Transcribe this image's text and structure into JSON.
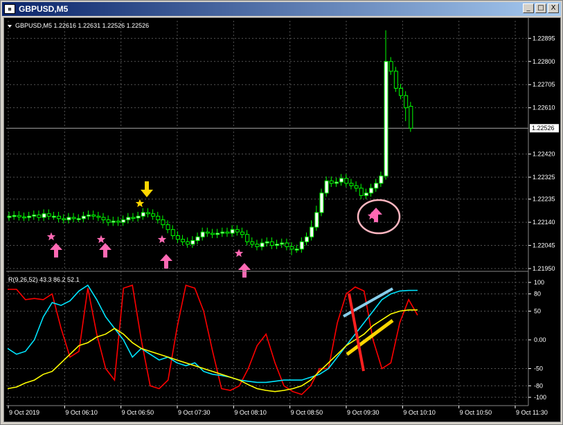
{
  "window": {
    "title": "GBPUSD,M5",
    "buttons": [
      "_",
      "□",
      "X"
    ]
  },
  "main_chart": {
    "header": "GBPUSD,M5  1.22616 1.22631 1.22526 1.22526",
    "current_price_label": "1.22526",
    "colors": {
      "background": "#000000",
      "bull_candle": "#ffffff",
      "candle_wick": "#00ff00",
      "grid": "#555555",
      "buy_arrow": "#ff69b4",
      "sell_arrow": "#ffd700",
      "highlight_circle": "#ffb6c1"
    }
  },
  "indicator": {
    "header": "R(9,26,52) 43.3 86.2 52.1",
    "colors": {
      "fast": "#ff0000",
      "medium": "#00e5ff",
      "slow": "#ffff00",
      "trend_light_blue": "#87ceeb",
      "trend_yellow": "#ffd700",
      "trend_red": "#ff2020"
    }
  },
  "chart_data": [
    {
      "type": "candlestick",
      "title": "GBPUSD,M5",
      "y_ticks": [
        "1.22895",
        "1.22800",
        "1.22705",
        "1.22610",
        "1.22420",
        "1.22325",
        "1.22235",
        "1.22140",
        "1.22045",
        "1.21950"
      ],
      "ylim": [
        1.2195,
        1.2295
      ],
      "x_ticks": [
        "9 Oct 2019",
        "9 Oct 06:10",
        "9 Oct 06:50",
        "9 Oct 07:30",
        "9 Oct 08:10",
        "9 Oct 08:50",
        "9 Oct 09:30",
        "9 Oct 10:10",
        "9 Oct 10:50",
        "9 Oct 11:30"
      ],
      "grid": true,
      "close": [
        1.22165,
        1.22168,
        1.22162,
        1.2216,
        1.22165,
        1.2217,
        1.2216,
        1.22175,
        1.22165,
        1.22165,
        1.22155,
        1.2215,
        1.2216,
        1.22155,
        1.22155,
        1.22165,
        1.2217,
        1.22165,
        1.2216,
        1.2215,
        1.2214,
        1.22145,
        1.2214,
        1.2215,
        1.2216,
        1.22158,
        1.22165,
        1.2218,
        1.22175,
        1.22165,
        1.2215,
        1.2213,
        1.2211,
        1.22085,
        1.2207,
        1.2206,
        1.2205,
        1.22065,
        1.2208,
        1.221,
        1.22095,
        1.2209,
        1.22095,
        1.221,
        1.22095,
        1.2211,
        1.221,
        1.2209,
        1.2206,
        1.2205,
        1.2204,
        1.22055,
        1.2206,
        1.22045,
        1.2205,
        1.22055,
        1.2204,
        1.2203,
        1.2203,
        1.2206,
        1.2208,
        1.2212,
        1.2218,
        1.2226,
        1.2231,
        1.223,
        1.22305,
        1.2232,
        1.223,
        1.2229,
        1.2228,
        1.2225,
        1.2226,
        1.2228,
        1.223,
        1.2233,
        1.228,
        1.2276,
        1.2269,
        1.2266,
        1.2261,
        1.22526
      ],
      "open": [
        1.2216,
        1.22165,
        1.22168,
        1.22162,
        1.2216,
        1.22165,
        1.2217,
        1.2216,
        1.22175,
        1.22165,
        1.22165,
        1.22155,
        1.2215,
        1.2216,
        1.22155,
        1.22155,
        1.22165,
        1.2217,
        1.22165,
        1.2216,
        1.2215,
        1.2214,
        1.22145,
        1.2214,
        1.2215,
        1.2216,
        1.22158,
        1.22165,
        1.2218,
        1.22175,
        1.22165,
        1.2215,
        1.2213,
        1.2211,
        1.22085,
        1.2207,
        1.2206,
        1.2205,
        1.22065,
        1.2208,
        1.221,
        1.22095,
        1.2209,
        1.22095,
        1.221,
        1.22095,
        1.2211,
        1.221,
        1.2209,
        1.2206,
        1.2205,
        1.2204,
        1.22055,
        1.2206,
        1.22045,
        1.2205,
        1.22055,
        1.2204,
        1.2203,
        1.2203,
        1.2206,
        1.2208,
        1.2212,
        1.2218,
        1.2226,
        1.2231,
        1.223,
        1.22305,
        1.2232,
        1.223,
        1.2229,
        1.2228,
        1.2225,
        1.2226,
        1.2228,
        1.223,
        1.2233,
        1.228,
        1.2276,
        1.2269,
        1.2266,
        1.22616
      ]
    },
    {
      "type": "line",
      "title": "R(9,26,52) 43.3 86.2 52.1",
      "y_ticks": [
        "100",
        "80",
        "50",
        "0.00",
        "-50",
        "-80",
        "-100"
      ],
      "ylim": [
        -100,
        100
      ],
      "series": [
        {
          "values": [
            88,
            88,
            70,
            72,
            70,
            80,
            20,
            -30,
            -20,
            90,
            10,
            -50,
            -70,
            90,
            95,
            0,
            -80,
            -85,
            -70,
            20,
            95,
            90,
            50,
            -20,
            -85,
            -88,
            -80,
            -50,
            -10,
            10,
            -40,
            -80,
            -90,
            -95,
            -80,
            -50,
            -50,
            30,
            80,
            92,
            85,
            0,
            -50,
            -40,
            30,
            70,
            43
          ]
        },
        {
          "values": [
            -15,
            -25,
            -20,
            0,
            40,
            65,
            60,
            68,
            85,
            95,
            70,
            40,
            20,
            0,
            -30,
            -15,
            -25,
            -35,
            -30,
            -40,
            -45,
            -40,
            -55,
            -60,
            -62,
            -65,
            -70,
            -72,
            -74,
            -74,
            -72,
            -70,
            -70,
            -70,
            -65,
            -60,
            -50,
            -30,
            -10,
            10,
            30,
            50,
            70,
            80,
            85,
            86,
            86.2
          ]
        },
        {
          "values": [
            -85,
            -82,
            -75,
            -70,
            -60,
            -55,
            -40,
            -25,
            -10,
            -5,
            5,
            10,
            20,
            10,
            -5,
            -15,
            -20,
            -25,
            -30,
            -35,
            -40,
            -45,
            -50,
            -55,
            -60,
            -65,
            -70,
            -78,
            -85,
            -88,
            -90,
            -88,
            -85,
            -80,
            -70,
            -55,
            -40,
            -25,
            -10,
            0,
            10,
            25,
            35,
            45,
            50,
            52,
            52.1
          ]
        }
      ]
    }
  ]
}
